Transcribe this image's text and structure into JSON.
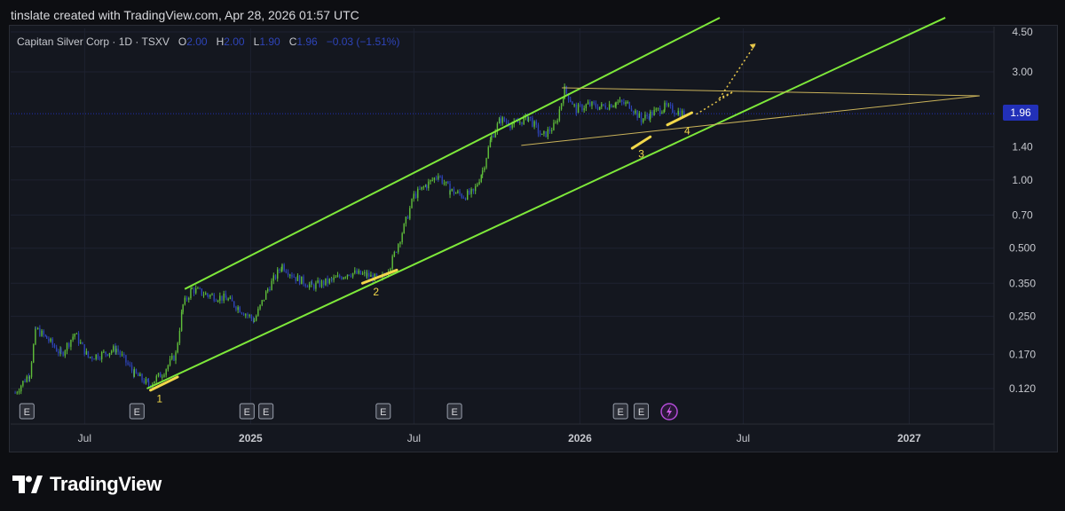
{
  "header": {
    "credit": "tinslate created with TradingView.com, Apr 28, 2026 01:57 UTC"
  },
  "legend": {
    "symbol": "Capitan Silver Corp · 1D · TSXV",
    "o_label": "O",
    "o_value": "2.00",
    "h_label": "H",
    "h_value": "2.00",
    "l_label": "L",
    "l_value": "1.90",
    "c_label": "C",
    "c_value": "1.96",
    "change": "−0.03 (−1.51%)"
  },
  "brand": {
    "name": "TradingView"
  },
  "colors": {
    "channel": "#7ee83a",
    "triangle": "#c9b25a",
    "candle_up": "#5fbd3a",
    "candle_down": "#2e44b8",
    "price_tag": "#2230b8"
  },
  "chart_data": {
    "type": "candlestick",
    "scale": "log",
    "ylim": [
      0.1,
      4.7
    ],
    "current_price": "1.96",
    "y_ticks": [
      "4.50",
      "3.00",
      "1.40",
      "1.00",
      "0.70",
      "0.500",
      "0.350",
      "0.250",
      "0.170",
      "0.120"
    ],
    "x_ticks": [
      "Jul",
      "2025",
      "Jul",
      "2026",
      "Jul",
      "2027"
    ],
    "series": [
      {
        "values": [
          [
            "2024-04-15",
            0.115
          ],
          [
            "2024-05-01",
            0.14
          ],
          [
            "2024-05-08",
            0.22
          ],
          [
            "2024-05-20",
            0.2
          ],
          [
            "2024-06-05",
            0.17
          ],
          [
            "2024-06-20",
            0.21
          ],
          [
            "2024-07-05",
            0.165
          ],
          [
            "2024-07-20",
            0.17
          ],
          [
            "2024-08-05",
            0.18
          ],
          [
            "2024-08-25",
            0.14
          ],
          [
            "2024-09-10",
            0.125
          ],
          [
            "2024-09-25",
            0.14
          ],
          [
            "2024-10-10",
            0.17
          ],
          [
            "2024-10-18",
            0.28
          ],
          [
            "2024-10-28",
            0.33
          ],
          [
            "2024-11-15",
            0.31
          ],
          [
            "2024-12-05",
            0.3
          ],
          [
            "2024-12-20",
            0.27
          ],
          [
            "2025-01-05",
            0.24
          ],
          [
            "2025-01-20",
            0.33
          ],
          [
            "2025-02-05",
            0.42
          ],
          [
            "2025-02-20",
            0.37
          ],
          [
            "2025-03-10",
            0.34
          ],
          [
            "2025-04-01",
            0.36
          ],
          [
            "2025-04-20",
            0.39
          ],
          [
            "2025-05-10",
            0.38
          ],
          [
            "2025-05-25",
            0.36
          ],
          [
            "2025-06-05",
            0.42
          ],
          [
            "2025-06-20",
            0.62
          ],
          [
            "2025-07-01",
            0.85
          ],
          [
            "2025-07-15",
            0.95
          ],
          [
            "2025-07-28",
            1.05
          ],
          [
            "2025-08-10",
            0.9
          ],
          [
            "2025-08-25",
            0.85
          ],
          [
            "2025-09-05",
            0.88
          ],
          [
            "2025-09-15",
            1.1
          ],
          [
            "2025-09-25",
            1.55
          ],
          [
            "2025-10-05",
            1.85
          ],
          [
            "2025-10-20",
            1.75
          ],
          [
            "2025-11-05",
            1.9
          ],
          [
            "2025-11-20",
            1.55
          ],
          [
            "2025-12-05",
            1.75
          ],
          [
            "2025-12-15",
            2.5
          ],
          [
            "2025-12-28",
            2.05
          ],
          [
            "2026-01-10",
            2.15
          ],
          [
            "2026-01-25",
            2.1
          ],
          [
            "2026-02-10",
            2.2
          ],
          [
            "2026-02-25",
            2.15
          ],
          [
            "2026-03-10",
            1.85
          ],
          [
            "2026-03-20",
            1.95
          ],
          [
            "2026-04-05",
            2.1
          ],
          [
            "2026-04-20",
            2.0
          ],
          [
            "2026-04-27",
            1.96
          ]
        ]
      }
    ],
    "annotations": [
      {
        "text": "1",
        "date": "2024-09-22",
        "price": 0.108
      },
      {
        "text": "2",
        "date": "2025-05-20",
        "price": 0.32
      },
      {
        "text": "3",
        "date": "2026-03-10",
        "price": 1.3
      },
      {
        "text": "4",
        "date": "2026-04-30",
        "price": 1.65
      }
    ],
    "event_markers": {
      "earnings_label": "E",
      "earnings_dates": [
        "2024-04-28",
        "2024-08-28",
        "2024-12-28",
        "2025-01-18",
        "2025-05-28",
        "2025-08-15",
        "2026-02-15",
        "2026-03-10"
      ],
      "split_date": "2026-04-10"
    }
  }
}
